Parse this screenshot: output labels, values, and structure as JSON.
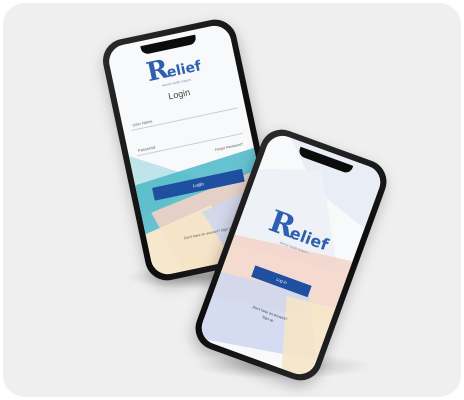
{
  "login_phone": {
    "logo_initial": "R",
    "logo_rest": "elief",
    "tagline": "Mental Health Support",
    "title": "Login",
    "username_label": "User Name",
    "password_label": "Password",
    "forgot_label": "Forgot Password?",
    "login_button": "Login",
    "register_link": "Don't have an account? Sign Up"
  },
  "welcome_phone": {
    "logo_initial": "R",
    "logo_rest": "elief",
    "tagline": "Mental Health Support",
    "login_button": "Log in",
    "signup_line1": "Don't have an account?",
    "signup_line2": "Sign up"
  },
  "colors": {
    "brand_blue": "#2f5fb0",
    "button_blue": "#1f4fa0",
    "teal": "#4cb8c8",
    "peach": "#f2d2c4",
    "lavender": "#cfd6ee"
  }
}
